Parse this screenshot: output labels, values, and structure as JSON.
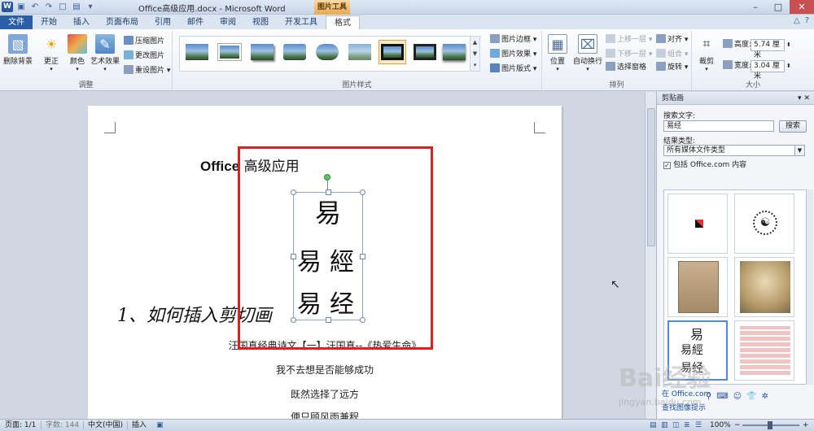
{
  "window": {
    "title": "Office高级应用.docx - Microsoft Word",
    "picture_tools": "图片工具"
  },
  "tabs": [
    {
      "label": "文件"
    },
    {
      "label": "开始"
    },
    {
      "label": "插入"
    },
    {
      "label": "页面布局"
    },
    {
      "label": "引用"
    },
    {
      "label": "邮件"
    },
    {
      "label": "审阅"
    },
    {
      "label": "视图"
    },
    {
      "label": "开发工具"
    },
    {
      "label": "格式"
    }
  ],
  "ribbon": {
    "adjust": {
      "label": "调整",
      "remove_bg": "删除背景",
      "corrections": "更正",
      "color": "颜色",
      "artistic": "艺术效果",
      "compress": "压缩图片",
      "change": "更改图片",
      "reset": "重设图片"
    },
    "styles": {
      "label": "图片样式",
      "border": "图片边框",
      "effects": "图片效果",
      "layout": "图片版式"
    },
    "arrange": {
      "label": "排列",
      "position": "位置",
      "wrap": "自动换行",
      "bring_forward": "上移一层",
      "send_backward": "下移一层",
      "selection_pane": "选择窗格",
      "align": "对齐",
      "group": "组合",
      "rotate": "旋转"
    },
    "size": {
      "label": "大小",
      "crop": "裁剪",
      "height_label": "高度:",
      "height_value": "5.74 厘米",
      "width_label": "宽度:",
      "width_value": "3.04 厘米"
    }
  },
  "document": {
    "title_en": "Office",
    "title_cn": "高级应用",
    "heading": "1、如何插入剪切画",
    "lines": [
      "汪国真经典诗文【一】汪国真--《热爱生命》",
      "我不去想是否能够成功",
      "既然选择了远方",
      "便只顾风雨兼程"
    ],
    "clip_glyphs": [
      "易",
      "易",
      "經",
      "易",
      "经"
    ]
  },
  "pane": {
    "title": "剪贴画",
    "search_label": "搜索文字:",
    "search_value": "易经",
    "search_button": "搜索",
    "result_type_label": "结果类型:",
    "result_type_value": "所有媒体文件类型",
    "include_office": "包括 Office.com 内容",
    "link1": "在 Office.com",
    "link2": "查找图像提示"
  },
  "status": {
    "page": "页面: 1/1",
    "words": "字数: 144",
    "language": "中文(中国)",
    "mode": "插入",
    "zoom": "100%"
  },
  "watermark": {
    "main": "Bai经验",
    "sub": "jingyan.baidu.com"
  }
}
